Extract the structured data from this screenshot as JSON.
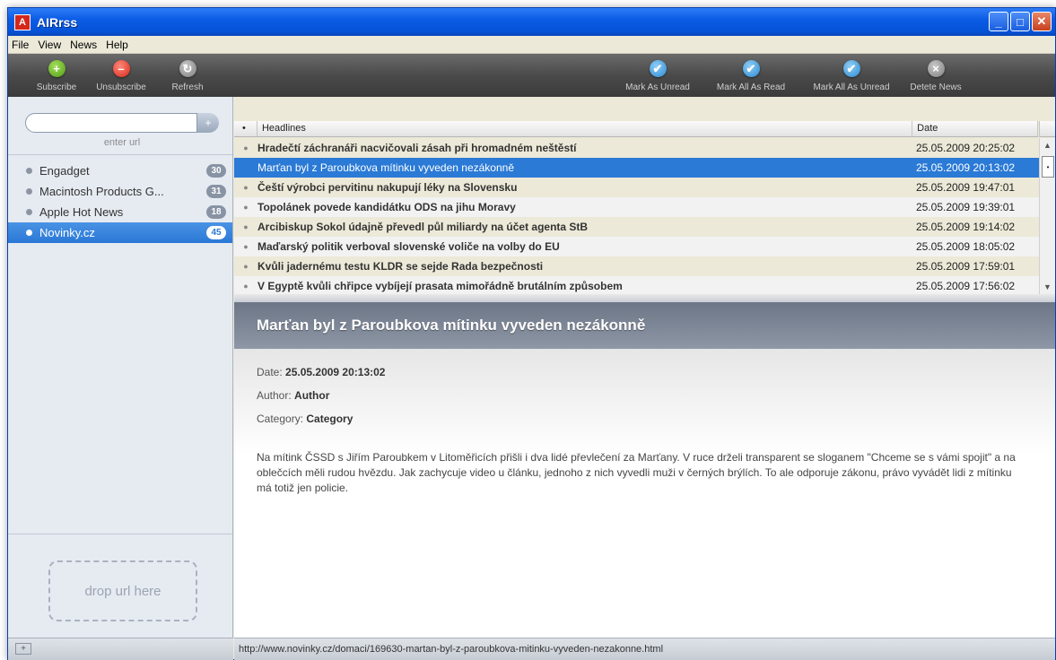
{
  "window": {
    "title": "AIRrss",
    "icon_letter": "A"
  },
  "menu": [
    "File",
    "View",
    "News",
    "Help"
  ],
  "toolbar": {
    "subscribe": "Subscribe",
    "unsubscribe": "Unsubscribe",
    "refresh": "Refresh",
    "mark_as_unread": "Mark As Unread",
    "mark_all_read": "Mark All As Read",
    "mark_all_unread": "Mark All As Unread",
    "delete_news": "Detete News"
  },
  "sidebar": {
    "url_placeholder": "",
    "enter_url_label": "enter url",
    "feeds": [
      {
        "name": "Engadget",
        "count": "30"
      },
      {
        "name": "Macintosh Products G...",
        "count": "31"
      },
      {
        "name": "Apple Hot News",
        "count": "18"
      },
      {
        "name": "Novinky.cz",
        "count": "45"
      }
    ],
    "selected_feed": 3,
    "drop_label": "drop url here"
  },
  "list": {
    "columns": [
      "•",
      "Headlines",
      "Date"
    ],
    "rows": [
      {
        "headline": "Hradečtí záchranáři nacvičovali zásah při hromadném neštěstí",
        "date": "25.05.2009 20:25:02"
      },
      {
        "headline": "Marťan byl z Paroubkova mítinku vyveden nezákonně",
        "date": "25.05.2009 20:13:02"
      },
      {
        "headline": "Čeští výrobci pervitinu nakupují léky na Slovensku",
        "date": "25.05.2009 19:47:01"
      },
      {
        "headline": "Topolánek povede kandidátku ODS na jihu Moravy",
        "date": "25.05.2009 19:39:01"
      },
      {
        "headline": "Arcibiskup Sokol údajně převedl půl miliardy na účet agenta StB",
        "date": "25.05.2009 19:14:02"
      },
      {
        "headline": "Maďarský politik verboval slovenské voliče na volby do EU",
        "date": "25.05.2009 18:05:02"
      },
      {
        "headline": "Kvůli jadernému testu KLDR se sejde Rada bezpečnosti",
        "date": "25.05.2009 17:59:01"
      },
      {
        "headline": "V Egyptě kvůli chřipce vybíjejí prasata mimořádně brutálním způsobem",
        "date": "25.05.2009 17:56:02"
      }
    ],
    "selected_row": 1
  },
  "article": {
    "title": "Marťan byl z Paroubkova mítinku vyveden nezákonně",
    "date_label": "Date:",
    "date": "25.05.2009 20:13:02",
    "author_label": "Author:",
    "author": "Author",
    "category_label": "Category:",
    "category": "Category",
    "body": "Na mítink ČSSD s Jiřím Paroubkem v Litoměřicích přišli i dva lidé převlečení za Marťany. V ruce drželi transparent se sloganem \"Chceme se s vámi spojit\" a na oblečcích měli rudou hvězdu. Jak zachycuje video u článku, jednoho z nich vyvedli muži v černých brýlích. To ale odporuje zákonu, právo vyvádět lidi z mítinku má totiž jen policie."
  },
  "statusbar": {
    "url": "http://www.novinky.cz/domaci/169630-martan-byl-z-paroubkova-mitinku-vyveden-nezakonne.html"
  }
}
